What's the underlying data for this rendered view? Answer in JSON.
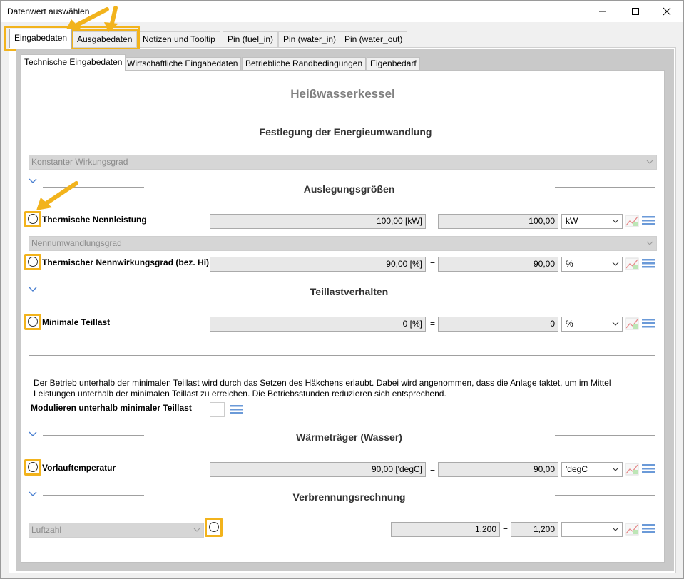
{
  "window": {
    "title": "Datenwert auswählen"
  },
  "outer_tabs": [
    "Eingabedaten",
    "Ausgabedaten",
    "Notizen und Tooltip",
    "Pin (fuel_in)",
    "Pin (water_in)",
    "Pin (water_out)"
  ],
  "inner_tabs": [
    "Technische Eingabedaten",
    "Wirtschaftliche Eingabedaten",
    "Betriebliche Randbedingungen",
    "Eigenbedarf"
  ],
  "page_title": "Heißwasserkessel",
  "sections": {
    "energie": "Festlegung der Energieumwandlung",
    "auslegung": "Auslegungsgrößen",
    "teillast": "Teillastverhalten",
    "waerme": "Wärmeträger (Wasser)",
    "verbrennung": "Verbrennungsrechnung"
  },
  "combos": {
    "wirkungsgrad": "Konstanter Wirkungsgrad",
    "nennumwandlung": "Nennumwandlungsgrad",
    "luftzahl": "Luftzahl"
  },
  "params": {
    "thermische_nennleistung": {
      "label": "Thermische Nennleistung",
      "value": "100,00 [kW]",
      "converted": "100,00",
      "unit": "kW"
    },
    "nennwirkungsgrad": {
      "label": "Thermischer Nennwirkungsgrad (bez. Hi)",
      "value": "90,00 [%]",
      "converted": "90,00",
      "unit": "%"
    },
    "minimale_teillast": {
      "label": "Minimale Teillast",
      "value": "0 [%]",
      "converted": "0",
      "unit": "%"
    },
    "vorlauftemperatur": {
      "label": "Vorlauftemperatur",
      "value": "90,00 ['degC]",
      "converted": "90,00",
      "unit": "'degC"
    },
    "luftzahl": {
      "label": "",
      "value": "1,200",
      "converted": "1,200",
      "unit": ""
    }
  },
  "eq_sign": "=",
  "description": "Der Betrieb unterhalb der minimalen Teillast wird durch das Setzen des Häkchens erlaubt. Dabei wird angenommen, dass die Anlage taktet, um im Mittel Leistungen unterhalb der minimalen Teillast zu erreichen. Die Betriebsstunden reduzieren sich entsprechend.",
  "modulieren_label": "Modulieren unterhalb minimaler Teillast",
  "colors": {
    "highlight": "#f2b31c",
    "icon_blue": "#4a7fd0"
  }
}
